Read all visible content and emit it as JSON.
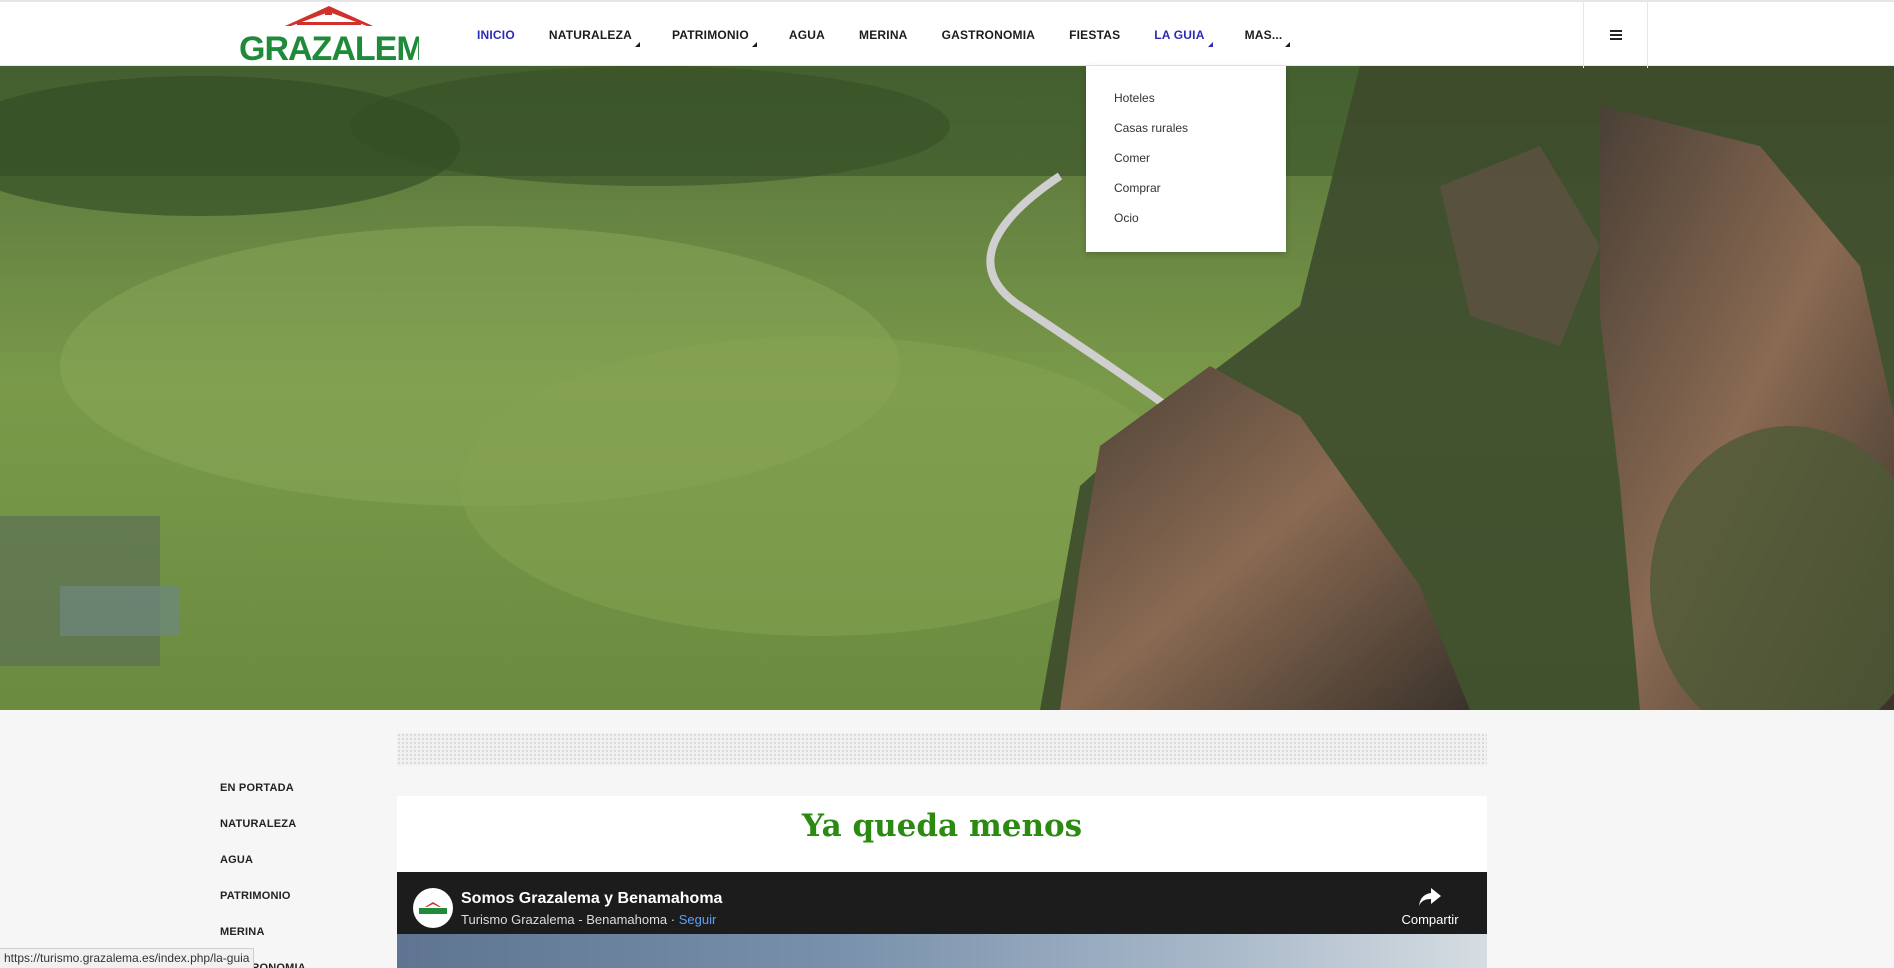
{
  "brand": {
    "logo_text": "GRAZALEMA"
  },
  "nav": {
    "items": [
      {
        "label": "INICIO"
      },
      {
        "label": "NATURALEZA"
      },
      {
        "label": "PATRIMONIO"
      },
      {
        "label": "AGUA"
      },
      {
        "label": "MERINA"
      },
      {
        "label": "GASTRONOMIA"
      },
      {
        "label": "FIESTAS"
      },
      {
        "label": "LA GUIA"
      },
      {
        "label": "MAS..."
      }
    ],
    "menu_icon": "hamburger-icon"
  },
  "dropdown": {
    "items": [
      "Hoteles",
      "Casas rurales",
      "Comer",
      "Comprar",
      "Ocio"
    ]
  },
  "sidebar": {
    "items": [
      "EN PORTADA",
      "NATURALEZA",
      "AGUA",
      "PATRIMONIO",
      "MERINA",
      "GASTRONOMIA"
    ]
  },
  "main": {
    "heading": "Ya queda menos",
    "video": {
      "channel": "Somos Grazalema y Benamahoma",
      "subtitle": "Turismo Grazalema - Benamahoma",
      "separator": "·",
      "follow_label": "Seguir",
      "share_label": "Compartir"
    }
  },
  "status_bar": {
    "url": "https://turismo.grazalema.es/index.php/la-guia"
  },
  "colors": {
    "nav_active": "#2b2bb5",
    "heading_green": "#2a8a12",
    "logo_green": "#1f8a3a",
    "logo_red": "#d2312b"
  }
}
